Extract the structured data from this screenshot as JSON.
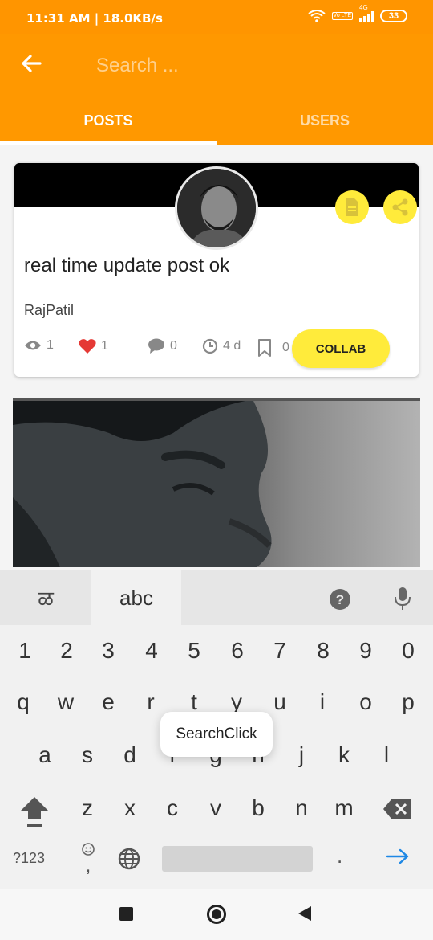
{
  "status_bar": {
    "time_speed": "11:31 AM | 18.0KB/s",
    "volte_label": "Vo LTE",
    "network_label": "4G",
    "battery": "33"
  },
  "app_bar": {
    "search_placeholder": "Search ...",
    "tabs": [
      {
        "label": "POSTS",
        "selected": true
      },
      {
        "label": "USERS",
        "selected": false
      }
    ],
    "color": "#ff9800"
  },
  "post": {
    "title": "real time update post ok",
    "author": "RajPatil",
    "views": "1",
    "likes": "1",
    "comments": "0",
    "age": "4 d",
    "bookmarks": "0",
    "collab_label": "COLLAB",
    "accent_color": "#ffeb3b"
  },
  "keyboard": {
    "language_key": "ळ",
    "abc_key": "abc",
    "number_row": [
      "1",
      "2",
      "3",
      "4",
      "5",
      "6",
      "7",
      "8",
      "9",
      "0"
    ],
    "row_1": [
      "q",
      "w",
      "e",
      "r",
      "t",
      "y",
      "u",
      "i",
      "o",
      "p"
    ],
    "row_2": [
      "a",
      "s",
      "d",
      "f",
      "g",
      "h",
      "j",
      "k",
      "l"
    ],
    "row_3": [
      "z",
      "x",
      "c",
      "v",
      "b",
      "n",
      "m"
    ],
    "symbols_key": "?123",
    "emoji_comma_key": ",",
    "period_key": "."
  },
  "tooltip": {
    "text": "SearchClick"
  }
}
